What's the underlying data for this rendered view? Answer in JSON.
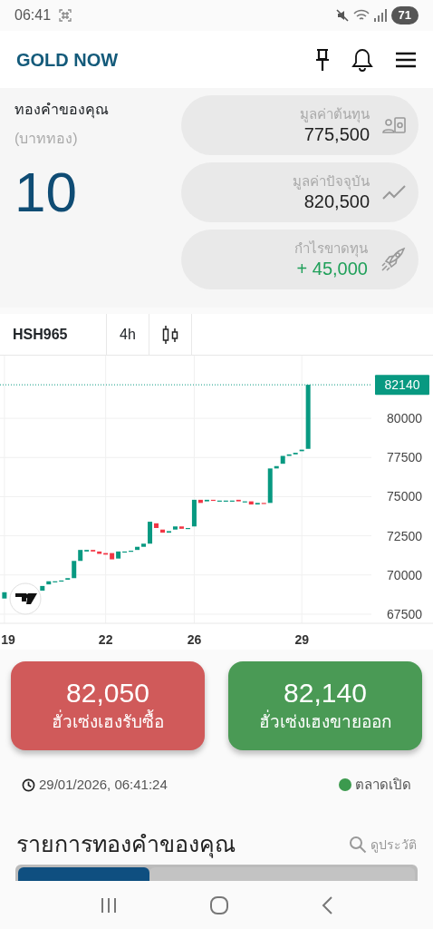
{
  "status_bar": {
    "time": "06:41",
    "battery": "71"
  },
  "header": {
    "title": "GOLD NOW"
  },
  "holdings": {
    "label": "ทองคำของคุณ",
    "unit": "(บาททอง)",
    "amount": "10"
  },
  "stats": [
    {
      "kind": "cost",
      "label": "มูลค่าต้นทุน",
      "value": "775,500",
      "positive": false
    },
    {
      "kind": "current",
      "label": "มูลค่าปัจจุบัน",
      "value": "820,500",
      "positive": false
    },
    {
      "kind": "profit",
      "label": "กำไรขาดทุน",
      "value": "+ 45,000",
      "positive": true
    }
  ],
  "chart_toolbar": {
    "symbol": "HSH965",
    "interval": "4h"
  },
  "chart": {
    "kind": "candlestick",
    "last_price": "82140",
    "price_axis": [
      "80000",
      "77500",
      "75000",
      "72500",
      "70000",
      "67500"
    ],
    "date_axis": [
      "19",
      "22",
      "26",
      "29"
    ]
  },
  "prices": [
    {
      "kind": "buy",
      "value": "82,050",
      "label": "ฮั่วเซ่งเฮงรับซื้อ"
    },
    {
      "kind": "sell",
      "value": "82,140",
      "label": "ฮั่วเซ่งเฮงขายออก"
    }
  ],
  "update": {
    "timestamp": "29/01/2026, 06:41:24",
    "market_status": "ตลาดเปิด",
    "market_open": true
  },
  "section": {
    "title": "รายการทองคำของคุณ",
    "history_link": "ดูประวัติ"
  },
  "tabs": [
    {
      "selected": true
    },
    {
      "selected": false
    }
  ]
}
